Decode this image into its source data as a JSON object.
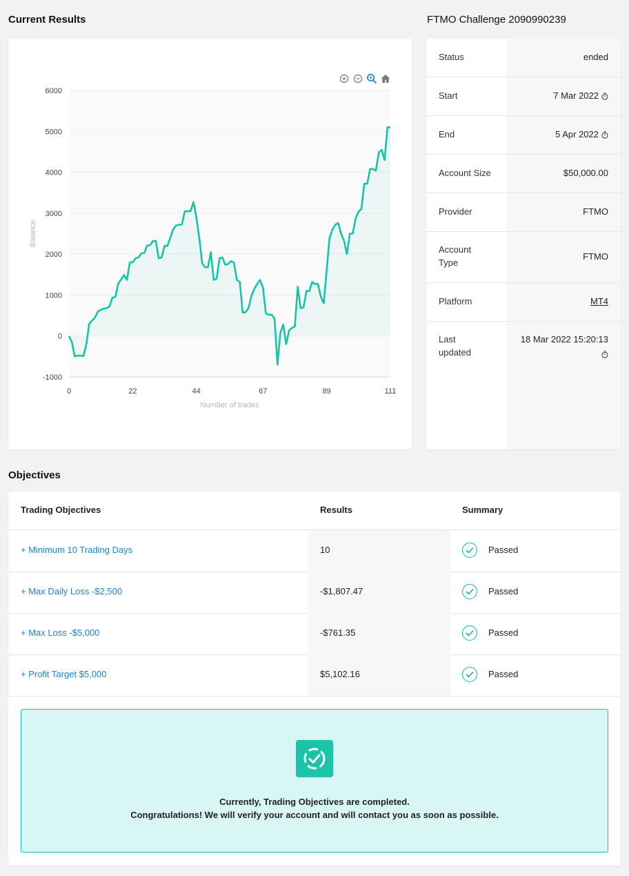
{
  "sections": {
    "current_results": "Current Results",
    "challenge_title": "FTMO Challenge 2090990239",
    "objectives": "Objectives"
  },
  "toolbar": {
    "icons": [
      "zoom-in-icon",
      "zoom-out-icon",
      "magnifier-icon",
      "home-icon"
    ]
  },
  "info": {
    "status": {
      "label": "Status",
      "value": "ended"
    },
    "start": {
      "label": "Start",
      "value": "7 Mar 2022"
    },
    "end": {
      "label": "End",
      "value": "5 Apr 2022"
    },
    "account_size": {
      "label": "Account Size",
      "value": "$50,000.00"
    },
    "provider": {
      "label": "Provider",
      "value": "FTMO"
    },
    "account_type": {
      "label": "Account Type",
      "value": "FTMO"
    },
    "platform": {
      "label": "Platform",
      "value": "MT4"
    },
    "last_updated": {
      "label": "Last updated",
      "value": "18 Mar 2022 15:20:13"
    }
  },
  "objectives": {
    "headers": {
      "name": "Trading Objectives",
      "results": "Results",
      "summary": "Summary"
    },
    "rows": [
      {
        "name": "+ Minimum 10 Trading Days",
        "result": "10",
        "summary": "Passed"
      },
      {
        "name": "+ Max Daily Loss -$2,500",
        "result": "-$1,807.47",
        "summary": "Passed"
      },
      {
        "name": "+ Max Loss -$5,000",
        "result": "-$761.35",
        "summary": "Passed"
      },
      {
        "name": "+ Profit Target $5,000",
        "result": "$5,102.16",
        "summary": "Passed"
      }
    ],
    "message_line1": "Currently, Trading Objectives are completed.",
    "message_line2": "Congratulations! We will verify your account and will contact you as soon as possible."
  },
  "colors": {
    "accent": "#12c4aa",
    "link": "#1f7fd6",
    "success_bg": "#d8f6f3"
  },
  "chart_data": {
    "type": "area",
    "title": "",
    "xlabel": "Number of trades",
    "ylabel": "Balance",
    "xlim": [
      0,
      111
    ],
    "ylim": [
      -1000,
      6000
    ],
    "x_ticks": [
      0,
      22,
      44,
      67,
      89,
      111
    ],
    "y_ticks": [
      -1000,
      0,
      1000,
      2000,
      3000,
      4000,
      5000,
      6000
    ],
    "grid": true,
    "series": [
      {
        "values": [
          [
            0,
            0
          ],
          [
            1,
            -150
          ],
          [
            2,
            -500
          ],
          [
            3,
            -480
          ],
          [
            4,
            -480
          ],
          [
            5,
            -490
          ],
          [
            6,
            -200
          ],
          [
            7,
            300
          ],
          [
            8,
            380
          ],
          [
            9,
            450
          ],
          [
            10,
            600
          ],
          [
            11,
            640
          ],
          [
            12,
            670
          ],
          [
            13,
            680
          ],
          [
            14,
            720
          ],
          [
            15,
            940
          ],
          [
            16,
            950
          ],
          [
            17,
            1280
          ],
          [
            18,
            1380
          ],
          [
            19,
            1490
          ],
          [
            20,
            1370
          ],
          [
            21,
            1800
          ],
          [
            22,
            1800
          ],
          [
            23,
            1900
          ],
          [
            24,
            1920
          ],
          [
            25,
            2020
          ],
          [
            26,
            2030
          ],
          [
            27,
            2210
          ],
          [
            28,
            2220
          ],
          [
            29,
            2320
          ],
          [
            30,
            2320
          ],
          [
            31,
            1900
          ],
          [
            32,
            1920
          ],
          [
            33,
            2200
          ],
          [
            34,
            2200
          ],
          [
            35,
            2400
          ],
          [
            36,
            2610
          ],
          [
            37,
            2700
          ],
          [
            38,
            2720
          ],
          [
            39,
            2720
          ],
          [
            40,
            3050
          ],
          [
            41,
            3050
          ],
          [
            42,
            3050
          ],
          [
            43,
            3270
          ],
          [
            44,
            2900
          ],
          [
            45,
            2400
          ],
          [
            46,
            1780
          ],
          [
            47,
            1680
          ],
          [
            48,
            1680
          ],
          [
            49,
            2050
          ],
          [
            50,
            1370
          ],
          [
            51,
            1400
          ],
          [
            52,
            1900
          ],
          [
            53,
            1920
          ],
          [
            54,
            1740
          ],
          [
            55,
            1760
          ],
          [
            56,
            1830
          ],
          [
            57,
            1790
          ],
          [
            58,
            1370
          ],
          [
            59,
            1320
          ],
          [
            60,
            570
          ],
          [
            61,
            580
          ],
          [
            62,
            680
          ],
          [
            63,
            980
          ],
          [
            64,
            1150
          ],
          [
            65,
            1270
          ],
          [
            66,
            1370
          ],
          [
            67,
            1180
          ],
          [
            68,
            550
          ],
          [
            69,
            520
          ],
          [
            70,
            520
          ],
          [
            71,
            420
          ],
          [
            72,
            -700
          ],
          [
            73,
            80
          ],
          [
            74,
            280
          ],
          [
            75,
            -200
          ],
          [
            76,
            130
          ],
          [
            77,
            200
          ],
          [
            78,
            230
          ],
          [
            79,
            1200
          ],
          [
            80,
            680
          ],
          [
            81,
            700
          ],
          [
            82,
            1100
          ],
          [
            83,
            1100
          ],
          [
            84,
            1320
          ],
          [
            85,
            1270
          ],
          [
            86,
            1270
          ],
          [
            87,
            960
          ],
          [
            88,
            800
          ],
          [
            89,
            1600
          ],
          [
            90,
            2400
          ],
          [
            91,
            2600
          ],
          [
            92,
            2720
          ],
          [
            93,
            2760
          ],
          [
            94,
            2500
          ],
          [
            95,
            2330
          ],
          [
            96,
            2000
          ],
          [
            97,
            2500
          ],
          [
            98,
            2500
          ],
          [
            99,
            2870
          ],
          [
            100,
            3040
          ],
          [
            101,
            3100
          ],
          [
            102,
            3720
          ],
          [
            103,
            3720
          ],
          [
            104,
            4080
          ],
          [
            105,
            4080
          ],
          [
            106,
            4040
          ],
          [
            107,
            4480
          ],
          [
            108,
            4550
          ],
          [
            109,
            4300
          ],
          [
            110,
            5100
          ],
          [
            111,
            5100
          ]
        ]
      }
    ]
  }
}
